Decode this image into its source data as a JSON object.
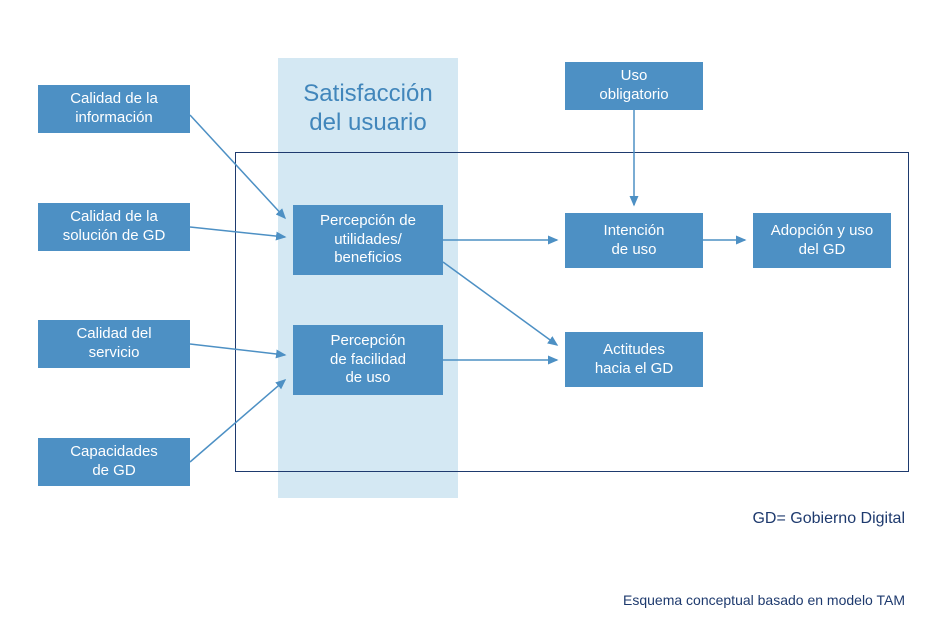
{
  "diagram": {
    "title": "Satisfacción\ndel usuario",
    "inputs": {
      "quality_info": "Calidad de la\ninformación",
      "quality_solution": "Calidad de la\nsolución de GD",
      "quality_service": "Calidad del\nservicio",
      "capabilities": "Capacidades\nde GD"
    },
    "mandatory_use": "Uso\nobligatorio",
    "perceptions": {
      "utility": "Percepción de\nutilidades/\nbeneficios",
      "ease": "Percepción\nde facilidad\nde uso"
    },
    "outcomes": {
      "intention": "Intención\nde uso",
      "attitudes": "Actitudes\nhacia el GD",
      "adoption": "Adopción y uso\ndel GD"
    },
    "legend": "GD= Gobierno Digital",
    "caption": "Esquema conceptual basado en modelo TAM"
  },
  "colors": {
    "box_fill": "#4d90c4",
    "bg_highlight": "#d4e8f3",
    "title_text": "#4186bb",
    "frame_border": "#1e3a6e",
    "arrow": "#4d90c4"
  }
}
